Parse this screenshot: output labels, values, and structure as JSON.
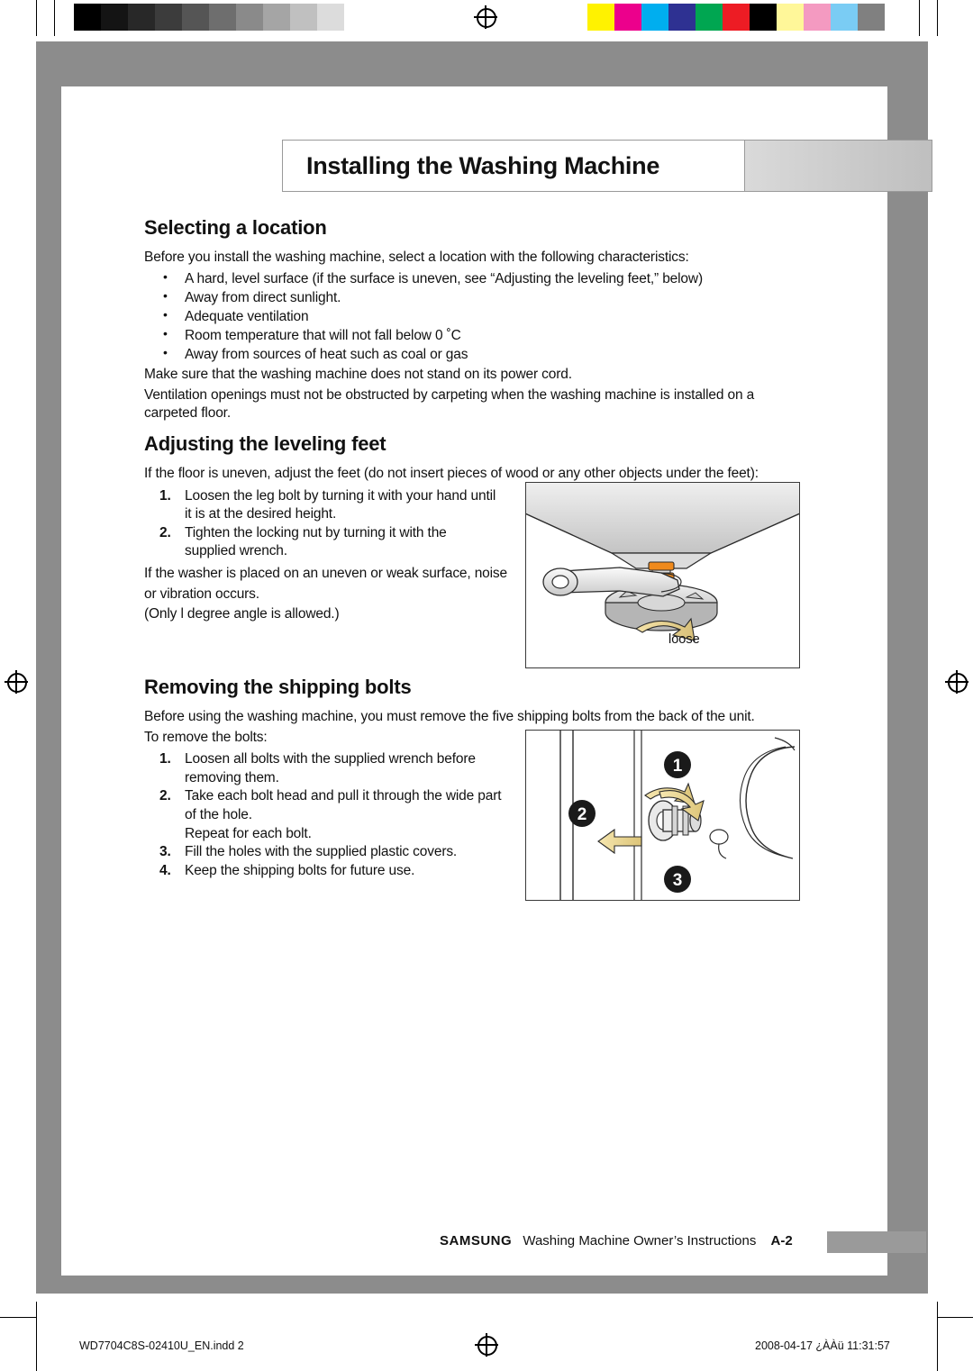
{
  "print_bar": {
    "grayscale_swatches": [
      "#000000",
      "#141414",
      "#282828",
      "#3c3c3c",
      "#555555",
      "#6e6e6e",
      "#8a8a8a",
      "#a5a5a5",
      "#c0c0c0",
      "#dcdcdc",
      "#ffffff"
    ],
    "color_swatches": [
      "#fff200",
      "#ec008c",
      "#00aeef",
      "#2e3192",
      "#00a651",
      "#ed1c24",
      "#000000",
      "#fff799",
      "#f49ac1",
      "#7accf4",
      "#808080"
    ]
  },
  "chapter": {
    "title": "Installing the Washing Machine"
  },
  "sections": [
    {
      "heading": "Selecting a location",
      "intro": "Before you install the washing machine, select a location with the following characteristics:",
      "bullets": [
        "A hard, level surface (if the surface is uneven, see “Adjusting the leveling feet,” below)",
        "Away from direct sunlight.",
        "Adequate ventilation",
        "Room temperature that will not fall below 0 ˚C",
        "Away from sources of heat such as coal or gas"
      ],
      "after_1": "Make sure that the washing machine does not stand on its power cord.",
      "after_2": "Ventilation openings must not be obstructed by carpeting when the washing machine is installed on a carpeted floor."
    },
    {
      "heading": "Adjusting the leveling feet",
      "intro": "If the floor is uneven, adjust the feet (do not insert pieces of wood or any other objects under the feet):",
      "steps": [
        {
          "num": "1.",
          "text": "Loosen the leg bolt by turning it with your hand until",
          "sub": "it is at the desired height."
        },
        {
          "num": "2.",
          "text": "Tighten the locking nut by turning it with the",
          "sub": "supplied wrench."
        }
      ],
      "note_1": "If the washer is placed on an uneven or weak surface, noise",
      "note_2": "or vibration occurs.",
      "note_3": "(Only l degree angle is allowed.)",
      "figure_caption": "loose"
    },
    {
      "heading": "Removing the shipping bolts",
      "intro_1": "Before using the washing machine, you must remove the five shipping bolts from the back of the unit.",
      "intro_2": "To remove the bolts:",
      "steps": [
        {
          "num": "1.",
          "text": "Loosen all bolts with the supplied wrench before",
          "sub": "removing them."
        },
        {
          "num": "2.",
          "text": "Take each bolt head and pull it through the wide part",
          "sub": "of the hole.",
          "sub2": "Repeat for each bolt."
        },
        {
          "num": "3.",
          "text": "Fill the holes with the supplied plastic covers.",
          "sub": ""
        },
        {
          "num": "4.",
          "text": "Keep the shipping bolts for future use.",
          "sub": ""
        }
      ],
      "figure_labels": [
        "1",
        "2",
        "3"
      ]
    }
  ],
  "footer": {
    "brand": "SAMSUNG",
    "text": "Washing Machine Owner’s Instructions",
    "page": "A-2"
  },
  "print_info": {
    "file": "WD7704C8S-02410U_EN.indd   2",
    "timestamp": "2008-04-17   ¿ÀÀü 11:31:57"
  }
}
